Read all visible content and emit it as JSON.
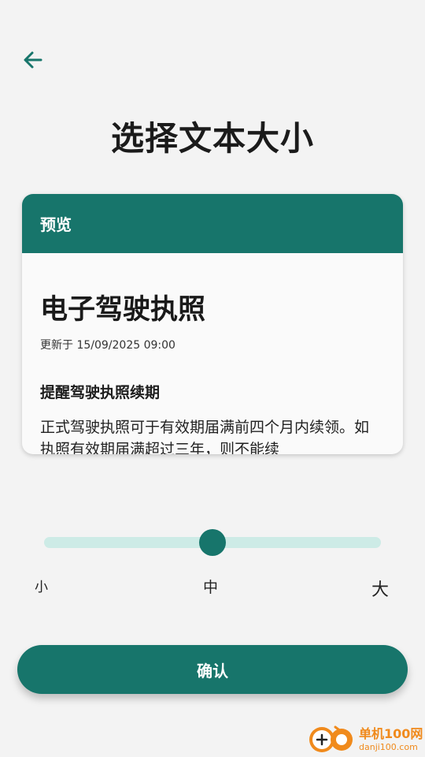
{
  "header": {
    "back_icon": "arrow-left-icon",
    "title": "选择文本大小"
  },
  "preview_card": {
    "header_label": "预览",
    "title": "电子驾驶执照",
    "updated": "更新于 15/09/2025 09:00",
    "section_title": "提醒驾驶执照续期",
    "paragraph": "正式驾驶执照可于有效期届满前四个月内续领。如执照有效期届满超过三年，则不能续"
  },
  "text_size_slider": {
    "labels": [
      "小",
      "中",
      "大"
    ],
    "selected": "中",
    "value_fraction": 0.5
  },
  "confirm_label": "确认",
  "watermark": {
    "name": "单机100网",
    "url": "danji100.com"
  },
  "colors": {
    "accent": "#17756b",
    "track": "#cdebe6",
    "background": "#f3f3f3"
  }
}
